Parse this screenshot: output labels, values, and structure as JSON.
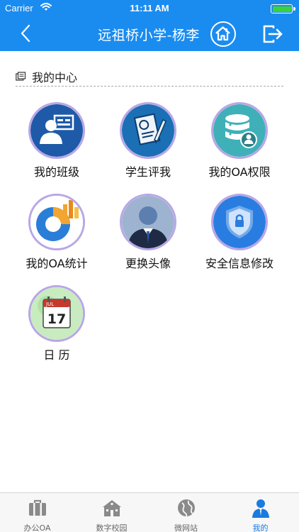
{
  "status_bar": {
    "carrier": "Carrier",
    "time": "11:11 AM"
  },
  "nav": {
    "title": "远祖桥小学-杨李",
    "back_icon": "chevron-left-icon",
    "home_icon": "home-icon",
    "logout_icon": "logout-icon"
  },
  "section": {
    "title": "我的中心"
  },
  "grid": [
    {
      "label": "我的班级",
      "icon": "class-icon"
    },
    {
      "label": "学生评我",
      "icon": "evaluation-icon"
    },
    {
      "label": "我的OA权限",
      "icon": "database-permission-icon"
    },
    {
      "label": "我的OA统计",
      "icon": "statistics-icon"
    },
    {
      "label": "更换头像",
      "icon": "avatar-icon"
    },
    {
      "label": "安全信息修改",
      "icon": "security-shield-icon"
    },
    {
      "label": "日 历",
      "icon": "calendar-icon",
      "calendar_day": "17",
      "calendar_month": "JUL"
    }
  ],
  "tabs": [
    {
      "label": "办公OA",
      "icon": "briefcase-icon",
      "active": false
    },
    {
      "label": "数字校园",
      "icon": "school-building-icon",
      "active": false
    },
    {
      "label": "微网站",
      "icon": "globe-icon",
      "active": false
    },
    {
      "label": "我的",
      "icon": "person-icon",
      "active": true
    }
  ],
  "colors": {
    "primary": "#1a8cf0",
    "ring": "#b9a6e6",
    "tab_active": "#1a7be0"
  }
}
